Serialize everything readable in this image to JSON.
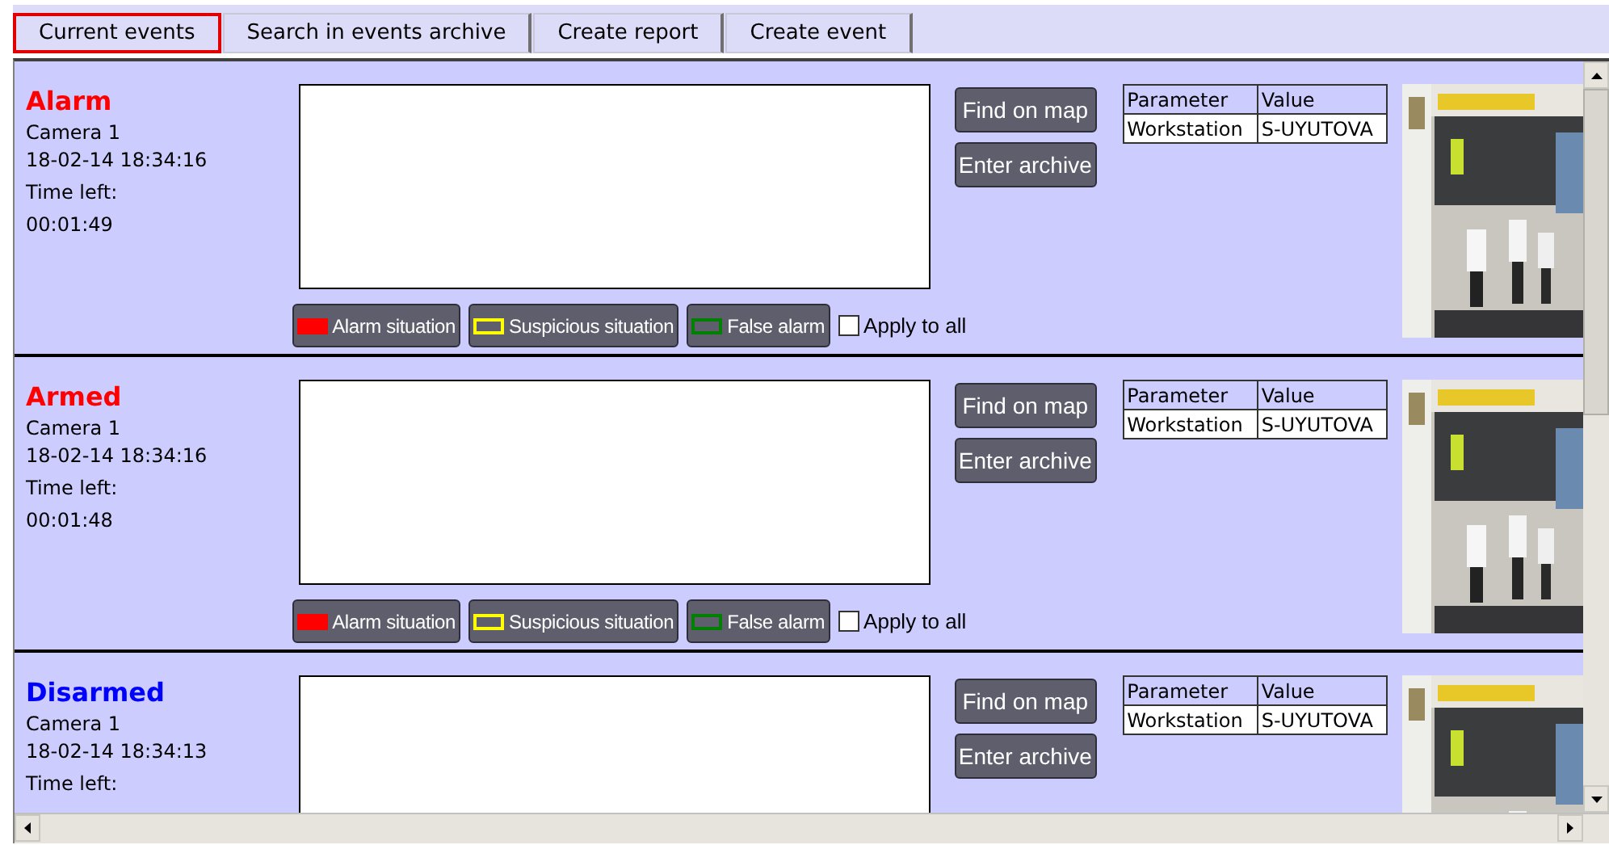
{
  "tabs": [
    {
      "label": "Current events",
      "selected": true
    },
    {
      "label": "Search in events archive",
      "selected": false
    },
    {
      "label": "Create report",
      "selected": false
    },
    {
      "label": "Create event",
      "selected": false
    }
  ],
  "events": [
    {
      "title": "Alarm",
      "color": "#ff0000",
      "camera": "Camera 1",
      "timestamp": "18-02-14 18:34:16",
      "time_left_label": "Time left:",
      "time_left": "00:01:49",
      "actions": [
        "Find on map",
        "Enter archive"
      ],
      "table": {
        "columns": [
          "Parameter",
          "Value"
        ],
        "rows": [
          [
            "Workstation",
            "S-UYUTOVA"
          ]
        ]
      },
      "classify": [
        {
          "label": "Alarm situation",
          "kind": "fill",
          "color": "#ff0000"
        },
        {
          "label": "Suspicious situation",
          "kind": "outline",
          "color": "#ffff00"
        },
        {
          "label": "False alarm",
          "kind": "outline",
          "color": "#008000"
        }
      ],
      "apply_to_all": {
        "label": "Apply to all",
        "checked": false
      }
    },
    {
      "title": "Armed",
      "color": "#ff0000",
      "camera": "Camera 1",
      "timestamp": "18-02-14 18:34:16",
      "time_left_label": "Time left:",
      "time_left": "00:01:48",
      "actions": [
        "Find on map",
        "Enter archive"
      ],
      "table": {
        "columns": [
          "Parameter",
          "Value"
        ],
        "rows": [
          [
            "Workstation",
            "S-UYUTOVA"
          ]
        ]
      },
      "classify": [
        {
          "label": "Alarm situation",
          "kind": "fill",
          "color": "#ff0000"
        },
        {
          "label": "Suspicious situation",
          "kind": "outline",
          "color": "#ffff00"
        },
        {
          "label": "False alarm",
          "kind": "outline",
          "color": "#008000"
        }
      ],
      "apply_to_all": {
        "label": "Apply to all",
        "checked": false
      }
    },
    {
      "title": "Disarmed",
      "color": "#0000ff",
      "camera": "Camera 1",
      "timestamp": "18-02-14 18:34:13",
      "time_left_label": "Time left:",
      "actions": [
        "Find on map",
        "Enter archive"
      ],
      "table": {
        "columns": [
          "Parameter",
          "Value"
        ],
        "rows": [
          [
            "Workstation",
            "S-UYUTOVA"
          ]
        ]
      }
    }
  ]
}
